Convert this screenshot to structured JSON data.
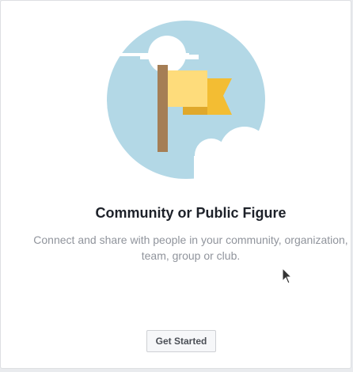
{
  "card": {
    "title": "Community or Public Figure",
    "description": "Connect and share with people in your community, organization, team, group or club.",
    "button_label": "Get Started"
  },
  "illustration": {
    "icon": "flag-illustration",
    "colors": {
      "circle": "#b3d8e6",
      "pole": "#a57e55",
      "flag_front": "#fedc7b",
      "flag_back": "#f3bd33",
      "cloud": "#ffffff"
    }
  }
}
